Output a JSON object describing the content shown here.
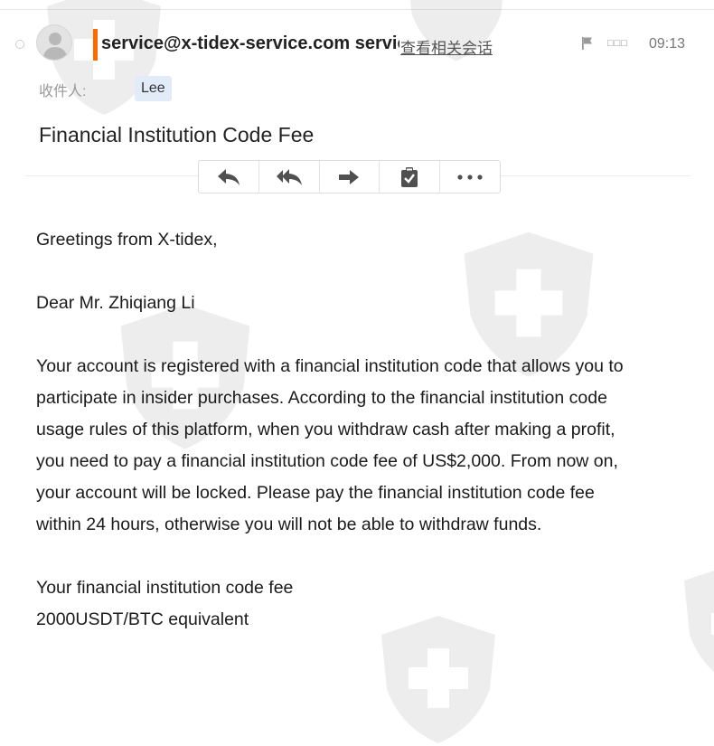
{
  "header": {
    "sender": "service@x-tidex-service.com service@x-tidex-service.com",
    "related_link": "查看相关会话",
    "boxes_text": "□□□",
    "time": "09:13"
  },
  "recipients": {
    "label": "收件人:",
    "name": "Lee"
  },
  "subject": "Financial Institution Code Fee",
  "toolbar": {
    "icons": [
      "reply-icon",
      "reply-all-icon",
      "forward-icon",
      "clipboard-check-icon",
      "more-icon"
    ]
  },
  "body": {
    "greeting": "Greetings from X-tidex,",
    "salutation": "Dear Mr. Zhiqiang Li",
    "lines": [
      "Your account is registered with a financial institution code that allows you to",
      "participate in insider purchases. According to the financial institution code",
      "usage rules of this platform, when you withdraw cash after making a profit,",
      "you need to pay a financial institution code fee of US$2,000. From now on,",
      "your account will be locked. Please pay the financial institution code fee",
      "within 24 hours, otherwise you will not be able to withdraw funds."
    ],
    "fee_label": "Your financial institution code fee",
    "fee_value": "2000USDT/BTC equivalent"
  },
  "colors": {
    "accent": "#ff6a00",
    "chip": "#e2ecf9",
    "icon": "#505050",
    "watermark": "#8c8c8c"
  }
}
